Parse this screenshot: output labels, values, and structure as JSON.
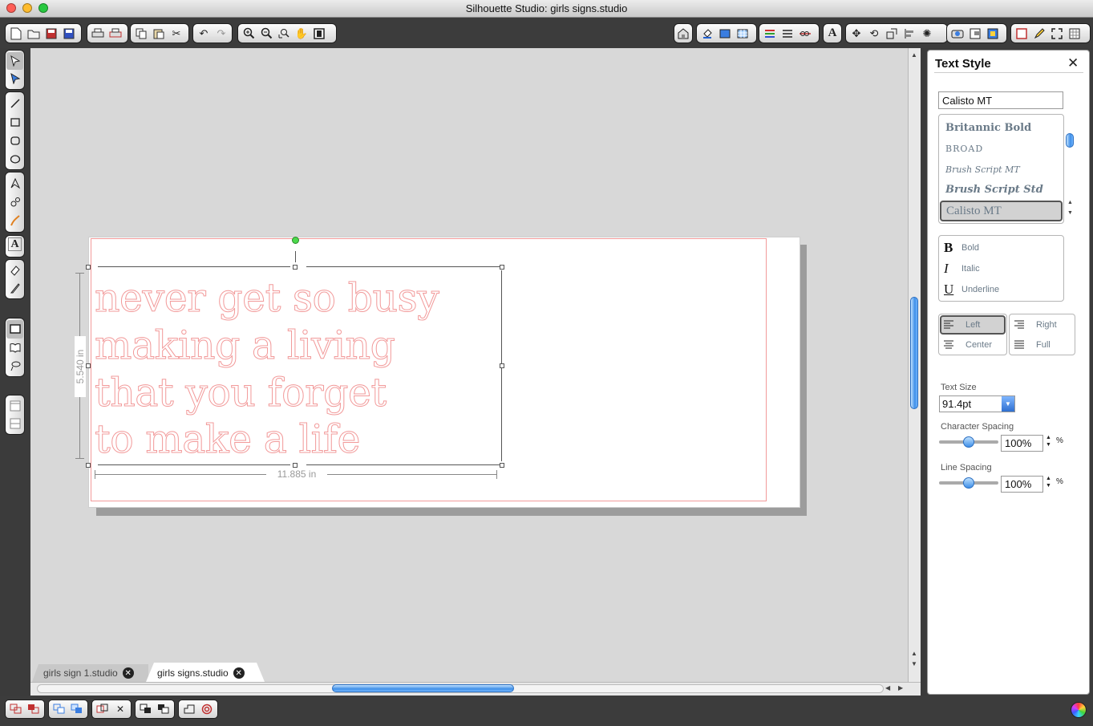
{
  "window": {
    "title": "Silhouette Studio: girls signs.studio"
  },
  "document": {
    "lines": [
      "never get so busy",
      "making a living",
      "that you forget",
      "to make a life"
    ],
    "height_label": "5.540 in",
    "width_label": "11.885 in"
  },
  "tabs": [
    {
      "label": "girls sign 1.studio",
      "active": false
    },
    {
      "label": "girls signs.studio",
      "active": true
    }
  ],
  "panel": {
    "title": "Text Style",
    "font_field": "Calisto MT",
    "fonts": [
      "Britannic Bold",
      "BROAD",
      "Brush Script MT",
      "Brush Script Std",
      "Calisto MT"
    ],
    "styles": [
      {
        "glyph": "B",
        "label": "Bold"
      },
      {
        "glyph": "I",
        "label": "Italic"
      },
      {
        "glyph": "U",
        "label": "Underline"
      }
    ],
    "align": {
      "left": "Left",
      "right": "Right",
      "center": "Center",
      "full": "Full"
    },
    "text_size": {
      "label": "Text Size",
      "value": "91.4pt"
    },
    "char_spacing": {
      "label": "Character Spacing",
      "value": "100%",
      "unit": "%",
      "level_pct": 100
    },
    "line_spacing": {
      "label": "Line Spacing",
      "value": "100%",
      "unit": "%",
      "level_pct": 100
    }
  },
  "colors": {
    "cut_line": "#f29a9a",
    "accent": "#3f8fe8",
    "panel_text": "#6a7a88"
  }
}
